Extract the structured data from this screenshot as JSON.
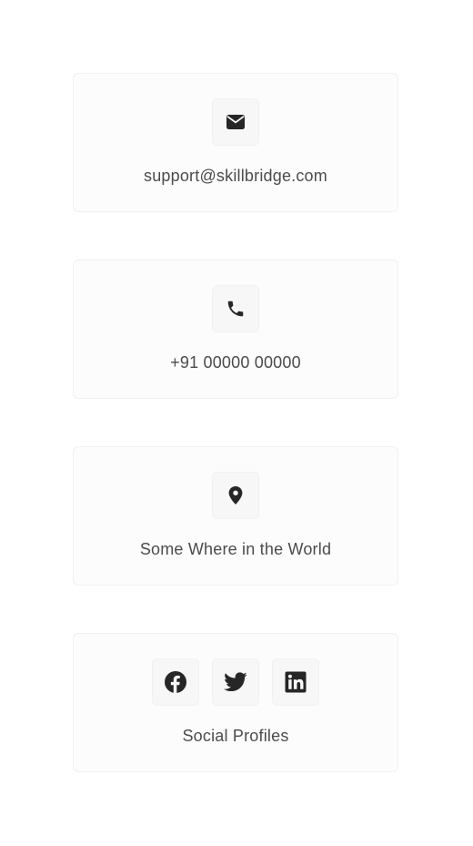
{
  "contact": {
    "email": {
      "label": "support@skillbridge.com",
      "icon": "mail-icon"
    },
    "phone": {
      "label": "+91 00000 00000",
      "icon": "phone-icon"
    },
    "location": {
      "label": "Some Where in the World",
      "icon": "map-pin-icon"
    },
    "social": {
      "label": "Social Profiles",
      "icons": [
        "facebook-icon",
        "twitter-icon",
        "linkedin-icon"
      ]
    }
  },
  "colors": {
    "card_background": "#fcfcfc",
    "card_border": "#f1f1f3",
    "icon_background": "#f7f7f8",
    "icon_color": "#262626",
    "text_color": "#4c4c4d"
  }
}
